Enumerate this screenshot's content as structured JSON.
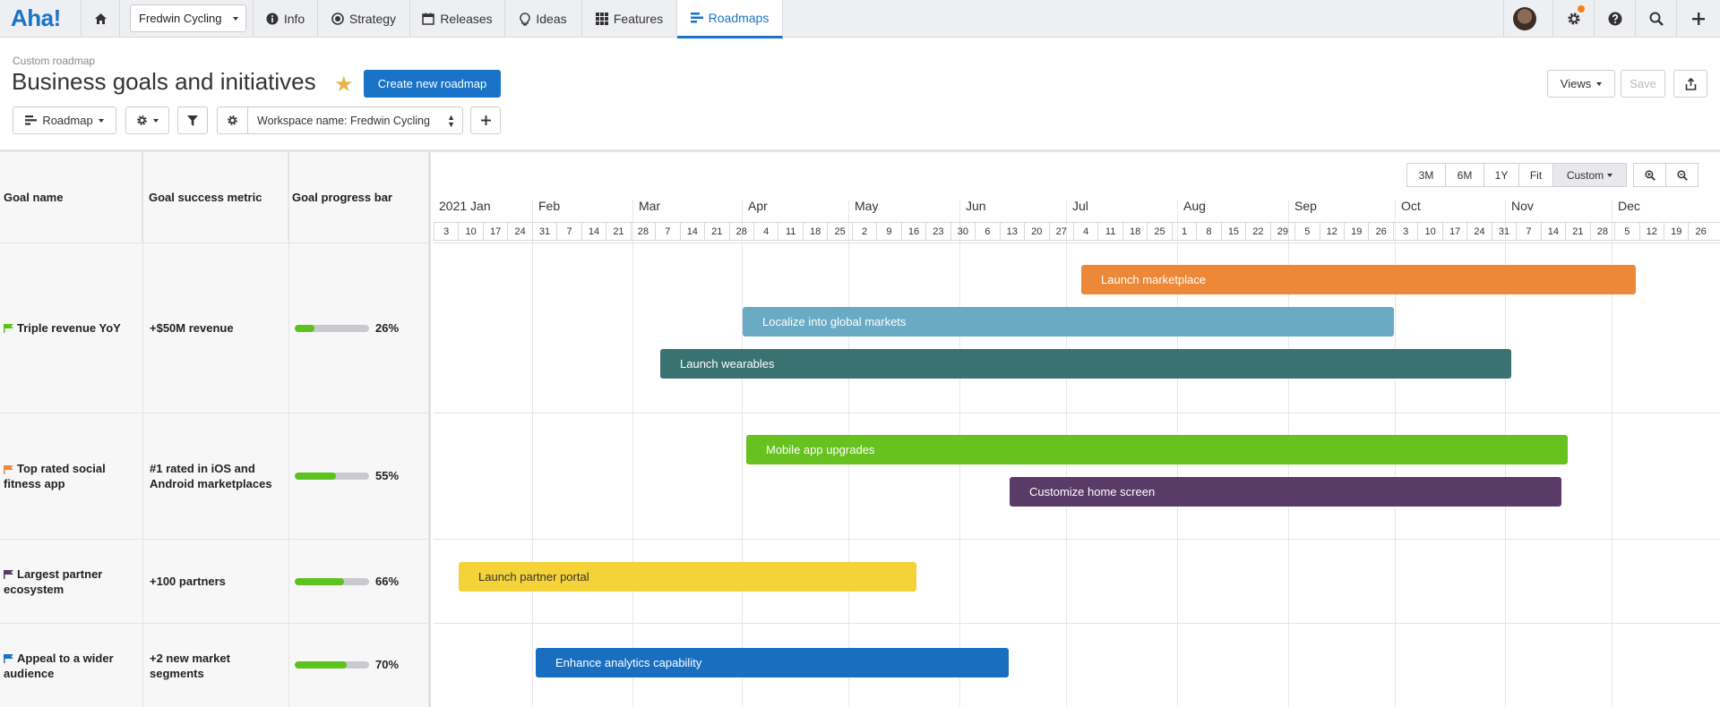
{
  "nav": {
    "logo": "Aha!",
    "workspace": "Fredwin Cycling",
    "tabs": [
      "Info",
      "Strategy",
      "Releases",
      "Ideas",
      "Features",
      "Roadmaps"
    ],
    "active_tab": "Roadmaps"
  },
  "header": {
    "breadcrumb": "Custom roadmap",
    "title": "Business goals and initiatives",
    "create_button": "Create new roadmap",
    "views_button": "Views",
    "save_button": "Save"
  },
  "toolbar": {
    "roadmap_button": "Roadmap",
    "filter_label": "Workspace name: Fredwin Cycling"
  },
  "table": {
    "columns": [
      "Goal name",
      "Goal success metric",
      "Goal progress bar"
    ],
    "rows": [
      {
        "goal_line1": "Triple revenue YoY",
        "goal_line2": "",
        "metric_line1": "+$50M revenue",
        "metric_line2": "",
        "progress": 26,
        "progress_label": "26%",
        "flag_color": "#5cc21e"
      },
      {
        "goal_line1": "Top rated social",
        "goal_line2": "fitness app",
        "metric_line1": "#1 rated in iOS and",
        "metric_line2": "Android marketplaces",
        "progress": 55,
        "progress_label": "55%",
        "flag_color": "#f0883e"
      },
      {
        "goal_line1": "Largest partner",
        "goal_line2": "ecosystem",
        "metric_line1": "+100 partners",
        "metric_line2": "",
        "progress": 66,
        "progress_label": "66%",
        "flag_color": "#5a3a66"
      },
      {
        "goal_line1": "Appeal to a wider",
        "goal_line2": "audience",
        "metric_line1": "+2 new market",
        "metric_line2": "segments",
        "progress": 70,
        "progress_label": "70%",
        "flag_color": "#1a73c7"
      }
    ]
  },
  "timeline": {
    "zoom_options": [
      "3M",
      "6M",
      "1Y",
      "Fit",
      "Custom"
    ],
    "active_zoom": "Custom",
    "months": [
      "2021 Jan",
      "Feb",
      "Mar",
      "Apr",
      "May",
      "Jun",
      "Jul",
      "Aug",
      "Sep",
      "Oct",
      "Nov",
      "Dec"
    ],
    "weeks": [
      "3",
      "10",
      "17",
      "24",
      "31",
      "7",
      "14",
      "21",
      "28",
      "7",
      "14",
      "21",
      "28",
      "4",
      "11",
      "18",
      "25",
      "2",
      "9",
      "16",
      "23",
      "30",
      "6",
      "13",
      "20",
      "27",
      "4",
      "11",
      "18",
      "25",
      "1",
      "8",
      "15",
      "22",
      "29",
      "5",
      "12",
      "19",
      "26",
      "3",
      "10",
      "17",
      "24",
      "31",
      "7",
      "14",
      "21",
      "28",
      "5",
      "12",
      "19",
      "26"
    ],
    "bars": [
      {
        "label": "Launch marketplace",
        "color": "#ec8838"
      },
      {
        "label": "Localize into global markets",
        "color": "#6aaac3"
      },
      {
        "label": "Launch wearables",
        "color": "#3a7272"
      },
      {
        "label": "Mobile app upgrades",
        "color": "#67c11f"
      },
      {
        "label": "Customize home screen",
        "color": "#5a3a66"
      },
      {
        "label": "Launch partner portal",
        "color": "#f4d238"
      },
      {
        "label": "Enhance analytics capability",
        "color": "#1a6ec0"
      }
    ]
  }
}
